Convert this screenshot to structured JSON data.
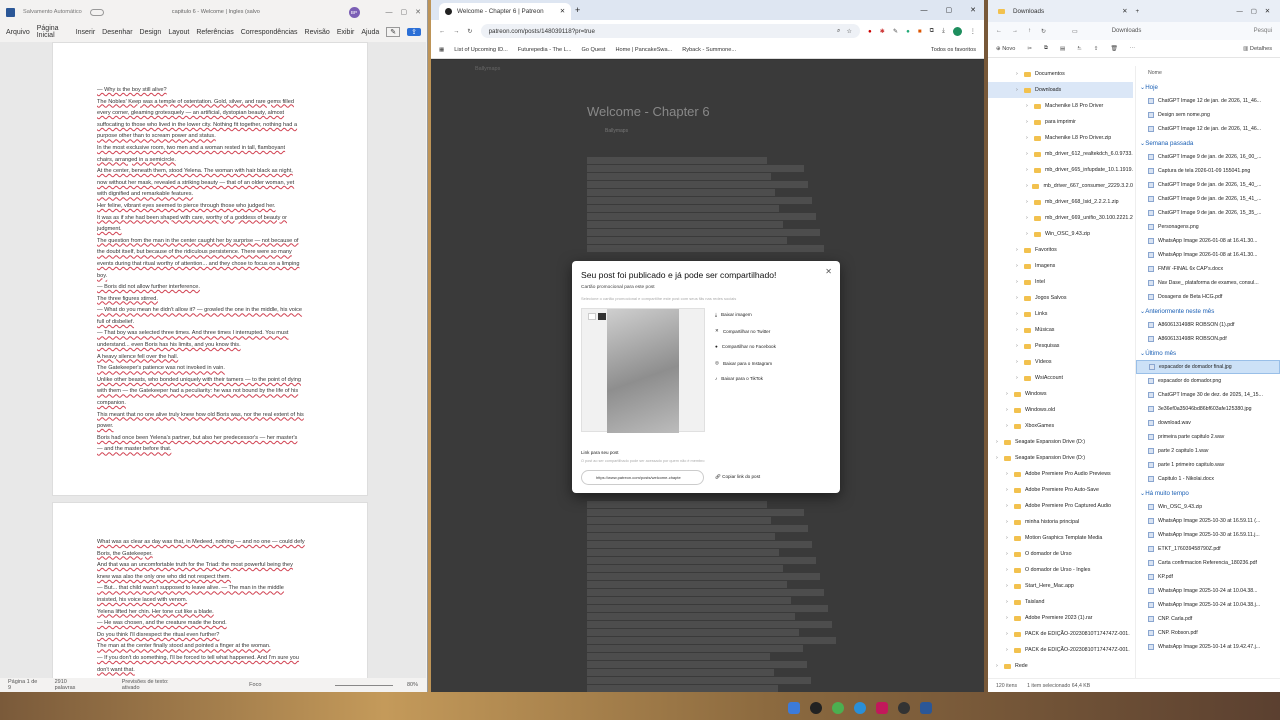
{
  "word": {
    "autosave_label": "Salvamento Automático",
    "doc_title": "capitulo 6 - Welcome | Ingles (salvo",
    "user_initials": "BP",
    "menu": [
      "Arquivo",
      "Página Inicial",
      "Inserir",
      "Desenhar",
      "Design",
      "Layout",
      "Referências",
      "Correspondências",
      "Revisão",
      "Exibir",
      "Ajuda"
    ],
    "page1": [
      "— Why is the boy still alive?",
      "The Nobles' Keep was a temple of ostentation. Gold, silver, and rare gems filled",
      "every corner, gleaming grotesquely — an artificial, dystopian beauty, almost",
      "suffocating to those who lived in the lower city. Nothing fit together, nothing had a",
      "purpose other than to scream power and status.",
      "In the most exclusive room, two men and a woman rested in tall, flamboyant",
      "chairs, arranged in a semicircle.",
      "At the center, beneath them, stood Yelena. The woman with hair black as night,",
      "now without her mask, revealed a striking beauty — that of an older woman, yet",
      "with dignified and remarkable features.",
      "Her feline, vibrant eyes seemed to pierce through those who judged her.",
      "It was as if she had been shaped with care, worthy of a goddess of beauty or",
      "judgment.",
      "The question from the man in the center caught her by surprise — not because of",
      "the doubt itself, but because of the ridiculous persistence. There were so many",
      "events during that ritual worthy of attention... and they chose to focus on a limping",
      "boy.",
      "— Boris did not allow further interference.",
      "The three figures stirred.",
      "— What do you mean he didn't allow it? — growled the one in the middle, his voice",
      "full of disbelief.",
      "— That boy was selected three times. And three times I interrupted. You must",
      "understand... even Boris has his limits, and you know this.",
      "A heavy silence fell over the hall.",
      "The Gatekeeper's patience was not invoked in vain.",
      "Unlike other beasts, who bonded uniquely with their tamers — to the point of dying",
      "with them — the Gatekeeper had a peculiarity: he was not bound by the life of his",
      "companion.",
      "This meant that no one alive truly knew how old Boris was, nor the real extent of his",
      "power.",
      "Boris had once been Yelena's partner, but also her predecessor's — her master's",
      "— and the master before that."
    ],
    "page2": [
      "What was as clear as day was that, in Medeed, nothing — and no one — could defy",
      "Boris, the Gatekeeper.",
      "And that was an uncomfortable truth for the Triad: the most powerful being they",
      "knew was also the only one who did not respect them.",
      "— But... that child wasn't supposed to leave alive. — The man in the middle",
      "insisted, his voice laced with venom.",
      "Yelena lifted her chin. Her tone cut like a blade.",
      "— He was chosen, and the creature made the bond.",
      "Do you think I'll disrespect the ritual even further?",
      "The man at the center finally stood and pointed a finger at the woman.",
      "— If you don't do something, I'll be forced to tell what happened. And I'm sure you",
      "don't want that."
    ],
    "status": {
      "page": "Página 1 de 9",
      "words": "2910 palavras",
      "prediction": "Previsões de texto: ativado",
      "focus": "Foco",
      "zoom": "80%"
    }
  },
  "chrome": {
    "tab_title": "Welcome - Chapter 6 | Patreon",
    "url": "patreon.com/posts/148039118?pr=true",
    "bookmarks": [
      "List of Upcoming ID...",
      "Futurepedia - The L...",
      "Go Quest",
      "Home | PancakeSwa...",
      "Ryback - Summone..."
    ],
    "all_favorites": "Todos os favoritos",
    "page": {
      "creator": "Ballymaps",
      "title": "Welcome - Chapter 6",
      "author": "Ballymaps"
    },
    "modal": {
      "title": "Seu post foi publicado e já pode ser compartilhado!",
      "promo_label": "Cartão promocional para este post",
      "promo_hint": "Selecione o cartão promocional e compartilhe este post com seus fãs nas redes sociais",
      "options": [
        "Baixar imagem",
        "Compartilhar no Twitter",
        "Compartilhar no Facebook",
        "Baixar para o Instagram",
        "Baixar para o TikTok"
      ],
      "link_label": "Link para seu post",
      "link_hint": "O post ao ser compartilhado pode ser acessado por quem não é membro",
      "post_url": "https://www.patreon.com/posts/welcome-chapte",
      "copy_label": "Copiar link do post"
    }
  },
  "explorer": {
    "tab_title": "Downloads",
    "breadcrumb": "Downloads",
    "search_placeholder": "Pesqui",
    "new_label": "Novo",
    "details_label": "Detalhes",
    "name_header": "Nome",
    "tree": [
      {
        "label": "Documentos",
        "d": 2
      },
      {
        "label": "Downloads",
        "d": 2,
        "sel": true
      },
      {
        "label": "Machenike L8 Pro Driver",
        "d": 3
      },
      {
        "label": "para imprimir",
        "d": 3
      },
      {
        "label": "Machenike L8 Pro Driver.zip",
        "d": 3
      },
      {
        "label": "mb_driver_612_realtekdch_6.0.9733.",
        "d": 3
      },
      {
        "label": "mb_driver_665_infupdate_10.1.1919.",
        "d": 3
      },
      {
        "label": "mb_driver_667_consumer_2229.3.2.0",
        "d": 3
      },
      {
        "label": "mb_driver_668_lsid_2.2.2.1.zip",
        "d": 3
      },
      {
        "label": "mb_driver_669_unifio_30.100.2221.2",
        "d": 3
      },
      {
        "label": "Win_OSC_9.43.zip",
        "d": 3
      },
      {
        "label": "Favoritos",
        "d": 2
      },
      {
        "label": "Imagens",
        "d": 2
      },
      {
        "label": "Intel",
        "d": 2
      },
      {
        "label": "Jogos Salvos",
        "d": 2
      },
      {
        "label": "Links",
        "d": 2
      },
      {
        "label": "Músicas",
        "d": 2
      },
      {
        "label": "Pesquisas",
        "d": 2
      },
      {
        "label": "Vídeos",
        "d": 2
      },
      {
        "label": "WsiAccount",
        "d": 2
      },
      {
        "label": "Windows",
        "d": 1
      },
      {
        "label": "Windows.old",
        "d": 1
      },
      {
        "label": "XboxGames",
        "d": 1
      },
      {
        "label": "Seagate Expansion Drive (D:)",
        "d": 0
      },
      {
        "label": "Seagate Expansion Drive (D:)",
        "d": 0
      },
      {
        "label": "Adobe Premiere Pro Audio Previews",
        "d": 1
      },
      {
        "label": "Adobe Premiere Pro Auto-Save",
        "d": 1
      },
      {
        "label": "Adobe Premiere Pro Captured Audio",
        "d": 1
      },
      {
        "label": "minha historia principal",
        "d": 1
      },
      {
        "label": "Motion Graphics Template Media",
        "d": 1
      },
      {
        "label": "O domador de Urso",
        "d": 1
      },
      {
        "label": "O domador de Urso - Ingles",
        "d": 1
      },
      {
        "label": "Start_Here_Mac.app",
        "d": 1
      },
      {
        "label": "Taisland",
        "d": 1
      },
      {
        "label": "Adobe Premiere 2023 (1).rar",
        "d": 1
      },
      {
        "label": "PACK de EDIÇÃO-20230810T174747Z-001.",
        "d": 1
      },
      {
        "label": "PACK de EDIÇÃO-20230810T174747Z-001.",
        "d": 1
      },
      {
        "label": "Rede",
        "d": 0
      }
    ],
    "files": [
      {
        "g": "Hoje"
      },
      {
        "n": "ChatGPT Image 12 de jan. de 2026, 11_46..."
      },
      {
        "n": "Design sem nome.png"
      },
      {
        "n": "ChatGPT Image 12 de jan. de 2026, 11_46..."
      },
      {
        "g": "Semana passada"
      },
      {
        "n": "ChatGPT Image 9 de jan. de 2026, 16_00_..."
      },
      {
        "n": "Captura de tela 2026-01-09 155041.png"
      },
      {
        "n": "ChatGPT Image 9 de jan. de 2026, 15_40_..."
      },
      {
        "n": "ChatGPT Image 9 de jan. de 2026, 15_41_..."
      },
      {
        "n": "ChatGPT Image 9 de jan. de 2026, 15_35_..."
      },
      {
        "n": "Personagens.png"
      },
      {
        "n": "WhatsApp Image 2026-01-08 at 16.41.30..."
      },
      {
        "n": "WhatsApp Image 2026-01-08 at 16.41.30..."
      },
      {
        "n": "FMW -FINAL 6x CAP's.docx"
      },
      {
        "n": "Nav Dase_ plataforma de exames, consul..."
      },
      {
        "n": "Dosagens de Beta HCG.pdf"
      },
      {
        "g": "Anteriormente neste mês"
      },
      {
        "n": "A8606131498R ROBSON (1).pdf"
      },
      {
        "n": "A8606131498R ROBSON.pdf"
      },
      {
        "g": "Último mês"
      },
      {
        "n": "espacador de domador final.jpg",
        "sel": true
      },
      {
        "n": "espacador do domador.png"
      },
      {
        "n": "ChatGPT Image 30 de dez. de 2025, 14_15..."
      },
      {
        "n": "3e36ef0a35046bd86bf603afe125380.jpg"
      },
      {
        "n": "download.wav"
      },
      {
        "n": "primeira parte capitulo 2.wav"
      },
      {
        "n": "parte 2 capitulo 1.wav"
      },
      {
        "n": "parte 1 primeiro capitulo.wav"
      },
      {
        "n": "Capitulo 1 - Nikolai.docx"
      },
      {
        "g": "Há muito tempo"
      },
      {
        "n": "Win_OSC_9.43.zip"
      },
      {
        "n": "WhatsApp Image 2025-10-30 at 16.59.11 (..."
      },
      {
        "n": "WhatsApp Image 2025-10-30 at 16.59.11.j..."
      },
      {
        "n": "ETKT_176039458790Z.pdf"
      },
      {
        "n": "Carta confirmacion Referencia_180236.pdf"
      },
      {
        "n": "KP.pdf"
      },
      {
        "n": "WhatsApp Image 2025-10-24 at 10.04.38..."
      },
      {
        "n": "WhatsApp Image 2025-10-24 at 10.04.38.j..."
      },
      {
        "n": "CNP. Carla.pdf"
      },
      {
        "n": "CNP. Robson.pdf"
      },
      {
        "n": "WhatsApp Image 2025-10-14 at 19.42.47.j..."
      }
    ],
    "status": {
      "count": "120 itens",
      "selected": "1 item selecionado 64,4 KB"
    }
  },
  "colors": {
    "accent": "#1a5fb4",
    "patreon_overlay": "#3a3a3a",
    "spell_underline": "#d04050"
  }
}
